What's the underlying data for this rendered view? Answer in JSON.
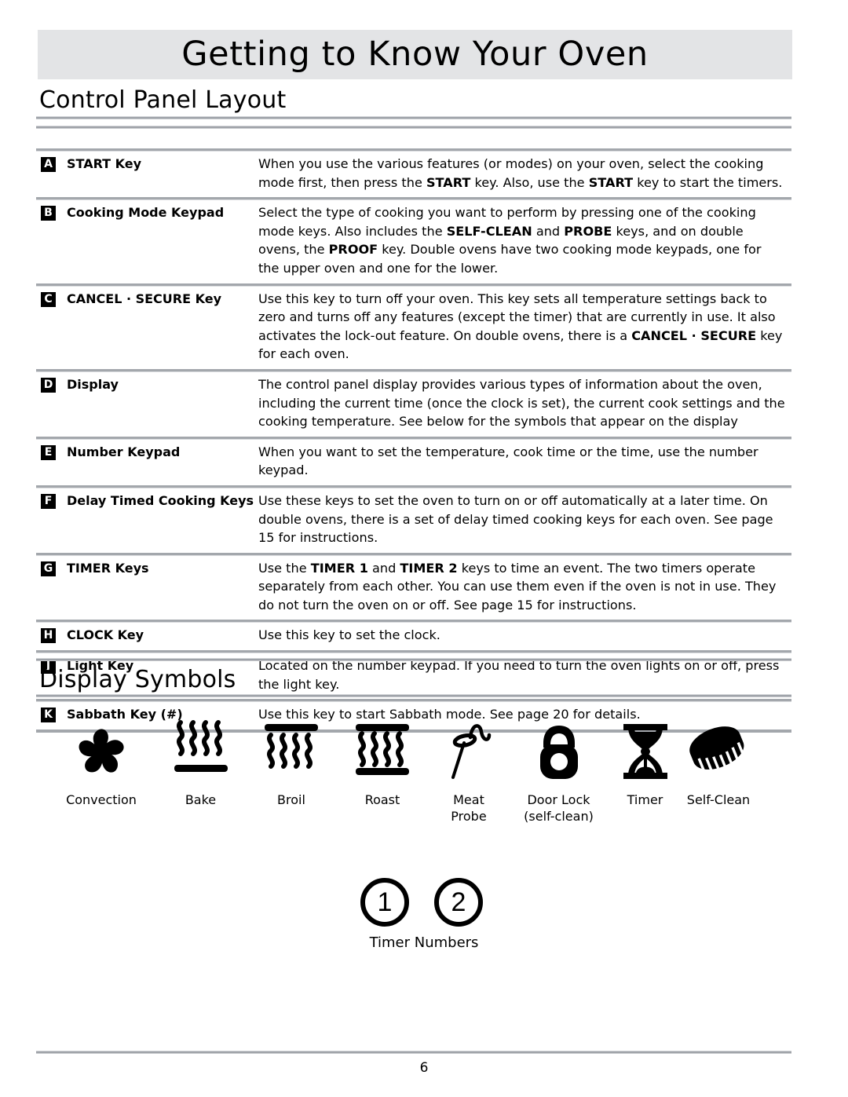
{
  "header": {
    "title": "Getting to Know Your Oven"
  },
  "sections": {
    "control_panel_layout": "Control Panel Layout",
    "display_symbols": "Display Symbols"
  },
  "table": {
    "rows": [
      {
        "badge": "A",
        "key": "START Key",
        "desc_html": "When you use the various features (or modes) on your oven, select the cooking mode first, then press the <b>START</b> key. Also, use the <b>START</b> key to start the timers."
      },
      {
        "badge": "B",
        "key": "Cooking Mode Keypad",
        "desc_html": "Select the type of cooking you want to perform by pressing one of the cooking mode keys. Also includes the <b>SELF-CLEAN</b> and <b>PROBE</b> keys, and on double ovens, the <b>PROOF</b> key. Double ovens have two cooking mode keypads, one for the upper oven and one for the lower."
      },
      {
        "badge": "C",
        "key": "CANCEL · SECURE Key",
        "desc_html": "Use this key to turn off your oven. This key sets all temperature settings back to zero and turns off any features (except the timer) that are currently in use. It also activates the lock-out feature. On double ovens, there is a <b>CANCEL · SECURE</b> key for each oven."
      },
      {
        "badge": "D",
        "key": "Display",
        "desc_html": "The control panel display provides various types of information about the oven, including the current time (once the clock is set), the current cook settings and the cooking temperature. See below for the symbols that appear on the display"
      },
      {
        "badge": "E",
        "key": "Number Keypad",
        "desc_html": "When you want to set the temperature, cook time or the time, use the number keypad."
      },
      {
        "badge": "F",
        "key": "Delay Timed Cooking Keys",
        "desc_html": "Use these keys to set the oven to turn on or off automatically at a later time. On double ovens, there is a set of delay timed cooking keys for each oven. See page 15 for instructions."
      },
      {
        "badge": "G",
        "key": "TIMER Keys",
        "desc_html": "Use the <b>TIMER 1</b> and <b>TIMER 2</b> keys to time an event. The two timers operate separately from each other. You can use them even if the oven is not in use. They do not turn the oven on or off. See page 15 for instructions."
      },
      {
        "badge": "H",
        "key": "CLOCK Key",
        "desc_html": "Use this key to set the clock."
      },
      {
        "badge": "J",
        "key": "Light Key",
        "desc_html": "Located on the number keypad. If you need to turn the oven lights on or off, press the light key."
      },
      {
        "badge": "K",
        "key": "Sabbath Key (#)",
        "desc_html": "Use this key to start Sabbath mode. See page 20 for details."
      }
    ]
  },
  "symbols": [
    {
      "icon": "convection-fan-icon",
      "label": "Convection"
    },
    {
      "icon": "bake-element-icon",
      "label": "Bake"
    },
    {
      "icon": "broil-element-icon",
      "label": "Broil"
    },
    {
      "icon": "roast-element-icon",
      "label": "Roast"
    },
    {
      "icon": "meat-probe-icon",
      "label": "Meat\nProbe"
    },
    {
      "icon": "door-lock-icon",
      "label": "Door Lock\n(self-clean)"
    },
    {
      "icon": "hourglass-timer-icon",
      "label": "Timer"
    },
    {
      "icon": "self-clean-brush-icon",
      "label": "Self-Clean"
    }
  ],
  "timer_numbers": {
    "circles": [
      "1",
      "2"
    ],
    "caption": "Timer Numbers"
  },
  "footer": {
    "page_number": "6"
  },
  "colors": {
    "masthead_background": "#e3e4e6",
    "rule": "#a3a7ac",
    "text": "#000000",
    "badge_background": "#000000"
  }
}
